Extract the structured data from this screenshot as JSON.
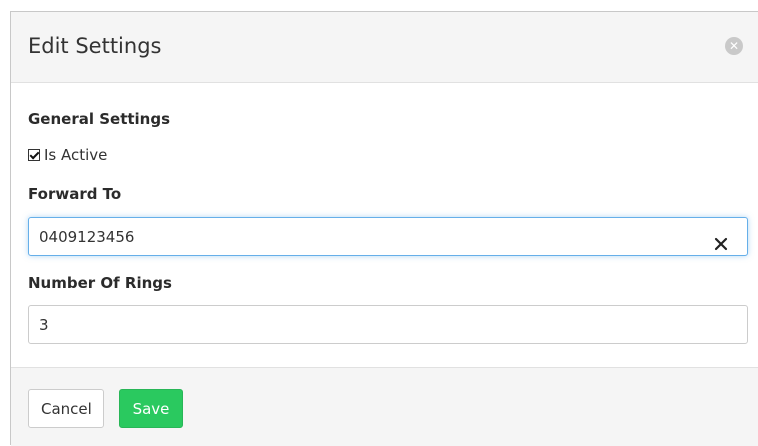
{
  "modal": {
    "title": "Edit Settings",
    "close_icon": "close-circle-icon"
  },
  "general_settings": {
    "title": "General Settings",
    "is_active_label": "Is Active",
    "is_active_checked": true
  },
  "forward_to": {
    "label": "Forward To",
    "value": "0409123456",
    "clear_icon": "clear-x-icon"
  },
  "number_of_rings": {
    "label": "Number Of Rings",
    "value": "3"
  },
  "footer": {
    "cancel_label": "Cancel",
    "save_label": "Save"
  },
  "colors": {
    "save_button": "#2ac95f",
    "focus_border": "#66afe9"
  }
}
